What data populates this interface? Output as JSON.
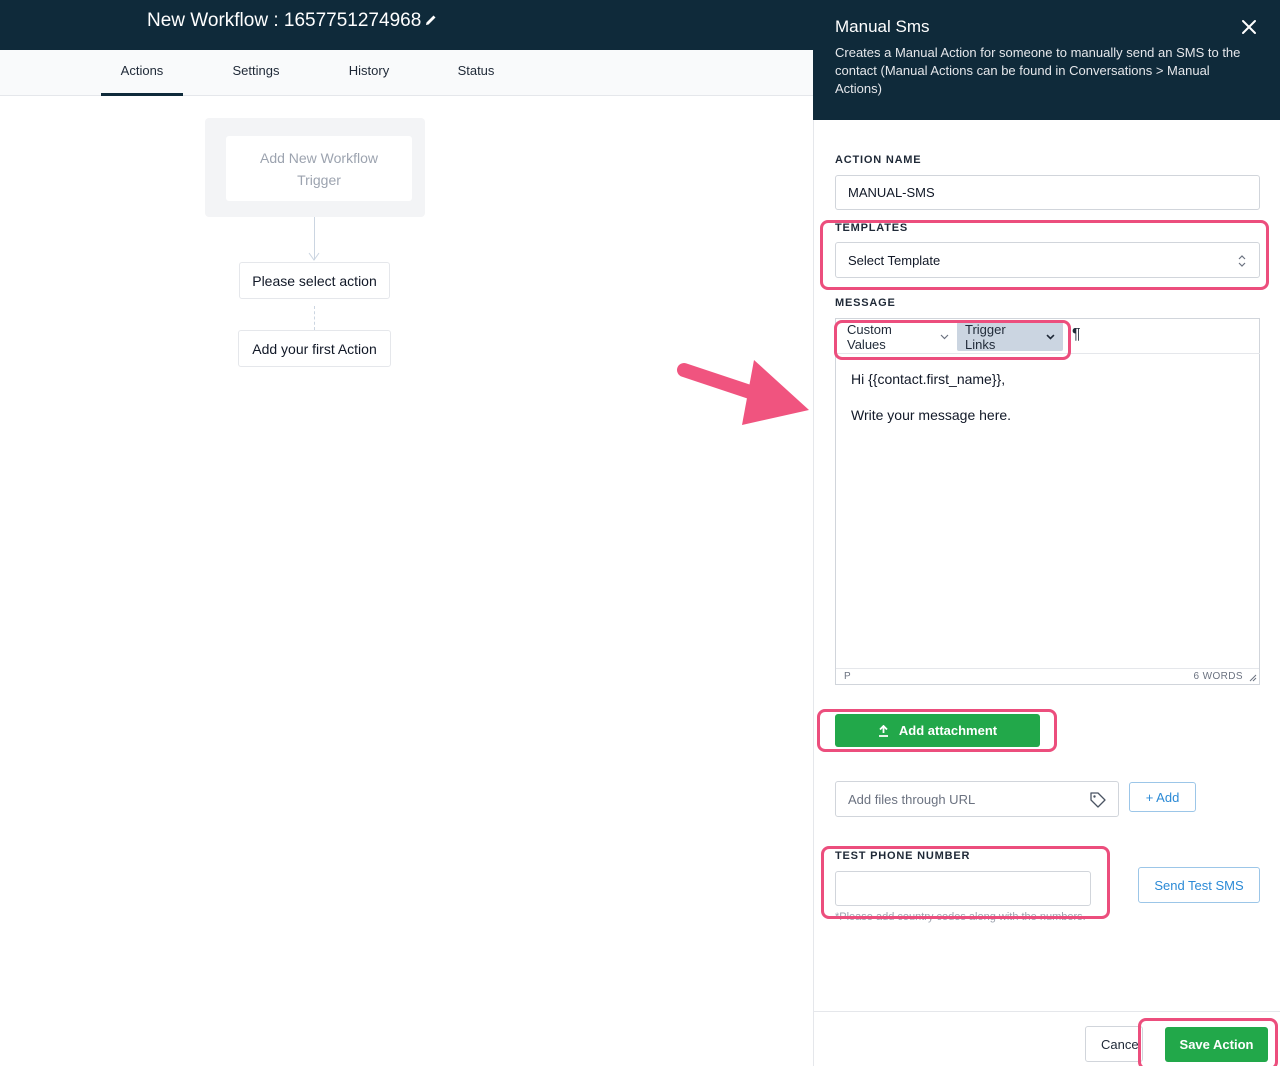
{
  "header": {
    "workflow_title": "New Workflow : 1657751274968"
  },
  "tabs": [
    {
      "label": "Actions",
      "active": true
    },
    {
      "label": "Settings",
      "active": false
    },
    {
      "label": "History",
      "active": false
    },
    {
      "label": "Status",
      "active": false
    }
  ],
  "canvas": {
    "trigger_label": "Add New Workflow Trigger",
    "select_action_label": "Please select action",
    "first_action_label": "Add your first Action"
  },
  "panel": {
    "title": "Manual Sms",
    "description": "Creates a Manual Action for someone to manually send an SMS to the contact (Manual Actions can be found in Conversations > Manual Actions)",
    "action_name_label": "ACTION NAME",
    "action_name_value": "MANUAL-SMS",
    "templates_label": "TEMPLATES",
    "template_selected": "Select Template",
    "message_label": "MESSAGE",
    "toolbar": {
      "custom_values": "Custom Values",
      "trigger_links": "Trigger Links",
      "paragraph_symbol": "¶"
    },
    "message_lines": [
      "Hi {{contact.first_name}},",
      "Write your message here."
    ],
    "editor_element": "P",
    "word_count": "6 WORDS",
    "add_attachment_label": "Add attachment",
    "url_placeholder": "Add files through URL",
    "add_url_button": "+ Add",
    "test_phone_label": "TEST PHONE NUMBER",
    "test_phone_value": "",
    "test_phone_hint": "*Please add country codes along with the numbers.",
    "send_test_label": "Send Test SMS",
    "cancel_label": "Cancel",
    "save_label": "Save Action"
  },
  "colors": {
    "header_bg": "#0f2a3a",
    "highlight": "#ec4e7d",
    "primary_green": "#22a84a",
    "link_blue": "#2b8ad6"
  }
}
